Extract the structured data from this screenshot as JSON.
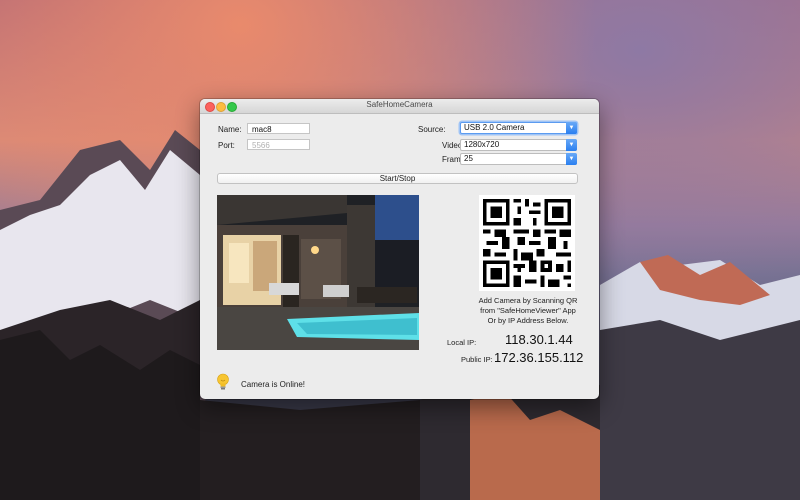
{
  "window": {
    "title": "SafeHomeCamera"
  },
  "form": {
    "name_label": "Name:",
    "name_value": "mac8",
    "port_label": "Port:",
    "port_placeholder": "5566",
    "source_label": "Source:",
    "source_value": "USB 2.0 Camera",
    "video_size_label": "Video Size:",
    "video_size_value": "1280x720",
    "frame_rate_label": "Frame Rate:",
    "frame_rate_value": "25"
  },
  "start_stop_label": "Start/Stop",
  "qr_caption": [
    "Add Camera by Scanning QR",
    "from \"SafeHomeViewer\" App",
    "Or by IP Address Below."
  ],
  "network": {
    "local_ip_label": "Local IP:",
    "local_ip": "118.30.1.44",
    "public_ip_label": "Public IP:",
    "public_ip": "172.36.155.112"
  },
  "status": {
    "text": "Camera is Online!",
    "icon": "lightbulb-icon"
  },
  "colors": {
    "accent": "#2a7ff0",
    "window_bg": "#ececec"
  }
}
